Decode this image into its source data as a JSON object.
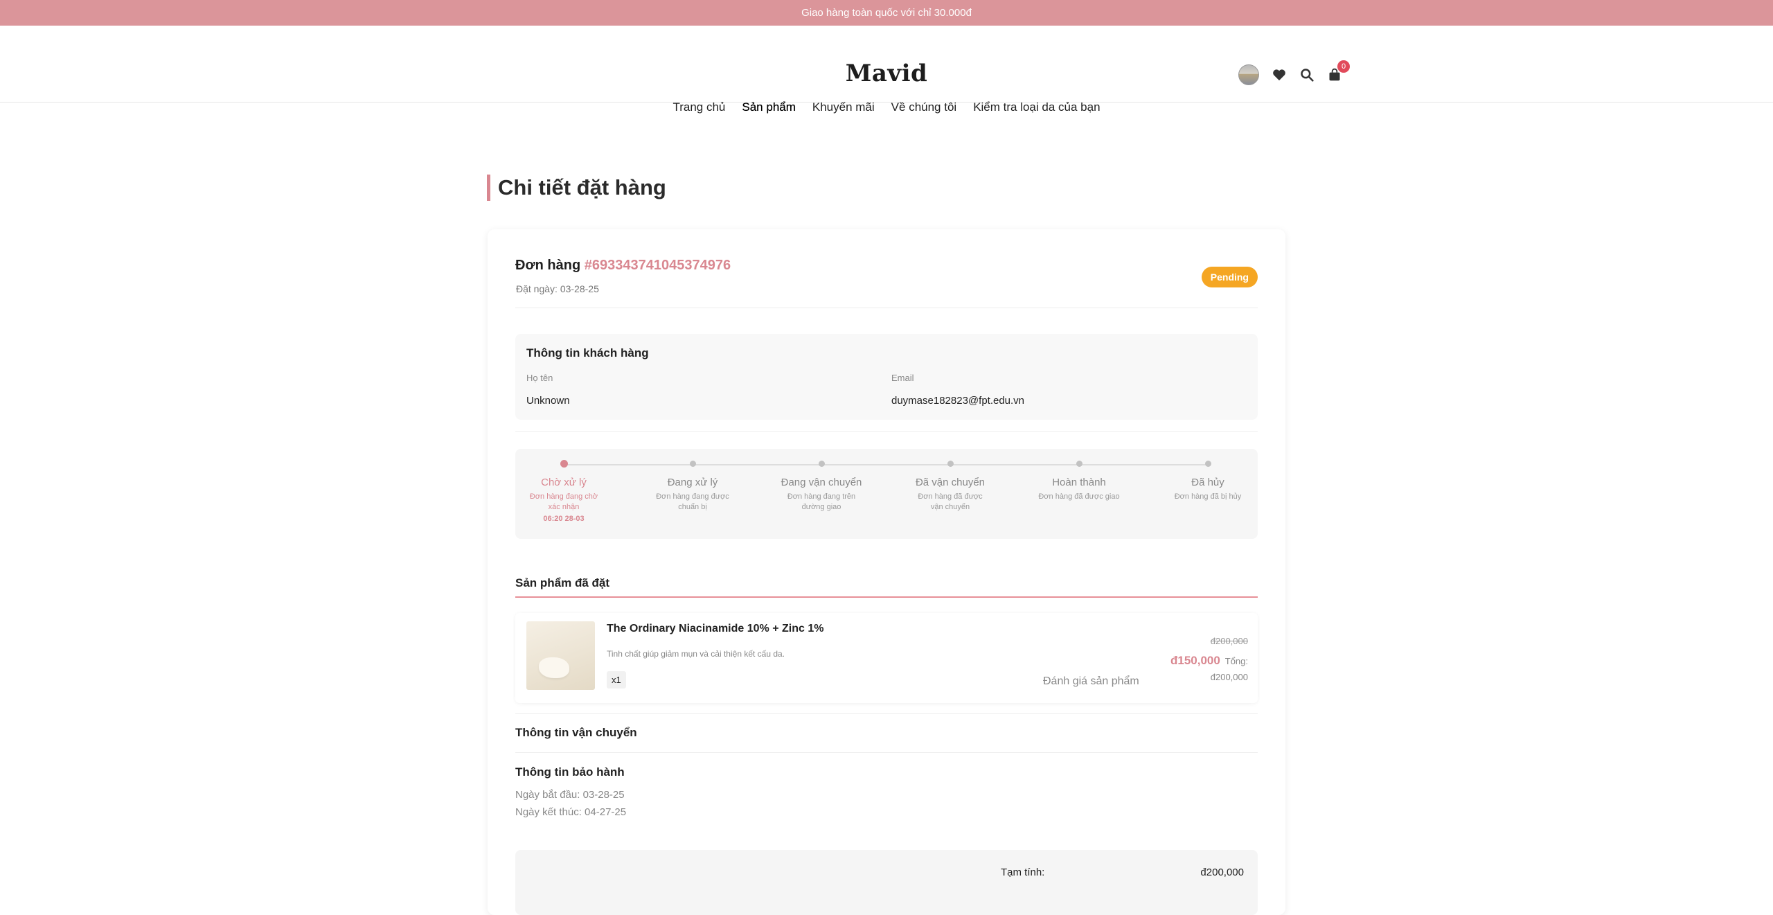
{
  "promo": {
    "text": "Giao hàng toàn quốc với chỉ 30.000đ"
  },
  "header": {
    "logo": "Mavid",
    "nav": [
      "Trang chủ",
      "Sản phẩm",
      "Khuyến mãi",
      "Về chúng tôi",
      "Kiểm tra loại da của bạn"
    ],
    "active_nav": "Sản phẩm",
    "icons": [
      "avatar",
      "heart-icon",
      "search-icon",
      "cart-icon"
    ],
    "cart_count": "0"
  },
  "page": {
    "title": "Chi tiết đặt hàng"
  },
  "order": {
    "label": "Đơn hàng",
    "id": "#693343741045374976",
    "date": "Đặt ngày: 03-28-25",
    "status": "Pending",
    "status_color": "#f5a623"
  },
  "customer": {
    "title": "Thông tin khách hàng",
    "name_label": "Họ tên",
    "name": "Unknown",
    "email_label": "Email",
    "email": "duymase182823@fpt.edu.vn"
  },
  "progress": {
    "steps": [
      {
        "label": "Chờ xử lý",
        "desc": "Đơn hàng đang chờ xác nhận",
        "time": "06:20 28-03",
        "active": true
      },
      {
        "label": "Đang xử lý",
        "desc": "Đơn hàng đang được chuẩn bị"
      },
      {
        "label": "Đang vận chuyển",
        "desc": "Đơn hàng đang trên đường giao"
      },
      {
        "label": "Đã vận chuyển",
        "desc": "Đơn hàng đã được vận chuyển"
      },
      {
        "label": "Hoàn thành",
        "desc": "Đơn hàng đã được giao"
      },
      {
        "label": "Đã hủy",
        "desc": "Đơn hàng đã bị hủy"
      }
    ]
  },
  "products_section": {
    "title": "Sản phẩm đã đặt",
    "items": [
      {
        "name": "The Ordinary Niacinamide 10% + Zinc 1%",
        "desc": "Tinh chất giúp giảm mụn và cải thiện kết cấu da.",
        "qty": "x1",
        "review": "Đánh giá sản phẩm",
        "price_old": "đ200,000",
        "price_new": "đ150,000",
        "total_label": "Tổng:",
        "total_value": "đ200,000"
      }
    ]
  },
  "shipping": {
    "title": "Thông tin vận chuyển"
  },
  "warranty": {
    "title": "Thông tin bảo hành",
    "start": "Ngày bắt đầu: 03-28-25",
    "end": "Ngày kết thúc: 04-27-25"
  },
  "summary": {
    "subtotal_label": "Tạm tính:",
    "subtotal_value": "đ200,000"
  },
  "colors": {
    "brand": "#db959a",
    "accent": "#d98790",
    "pending": "#f5a623"
  }
}
